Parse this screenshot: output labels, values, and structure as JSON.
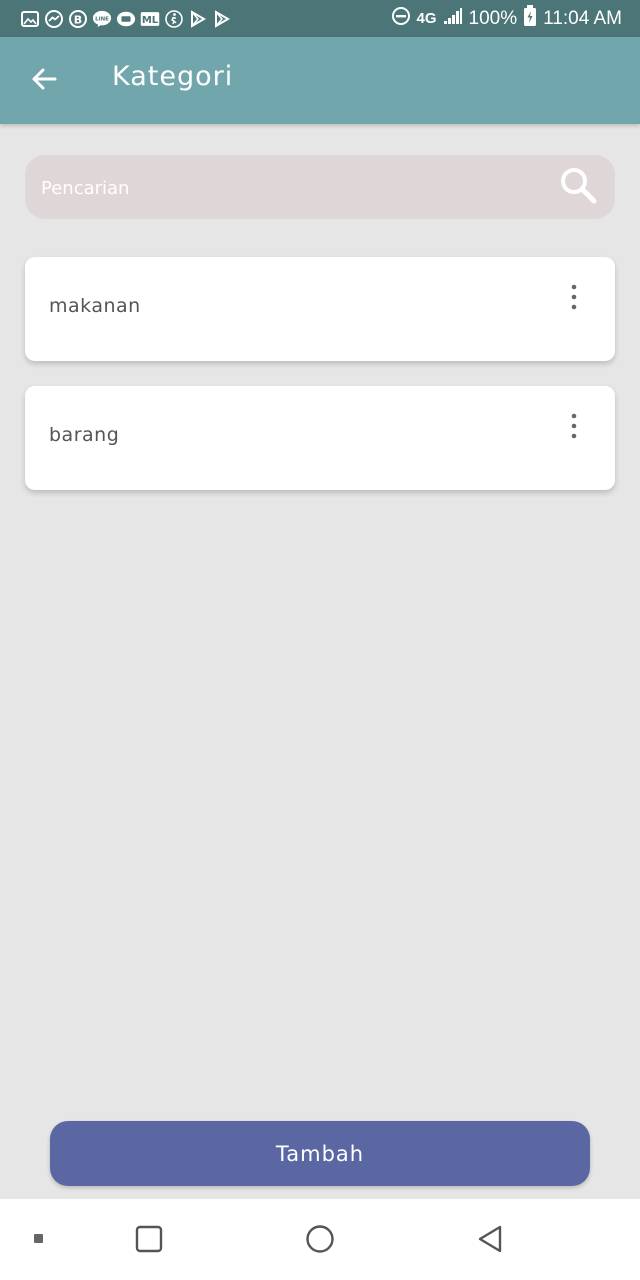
{
  "status_bar": {
    "network": "4G",
    "battery": "100%",
    "time": "11:04 AM",
    "background_color": "#4b7577"
  },
  "app_bar": {
    "title": "Kategori",
    "back_icon": "arrow-left-icon",
    "background_color": "#71a6ad"
  },
  "search": {
    "placeholder": "Pencarian",
    "value": "",
    "icon": "search-icon"
  },
  "categories": [
    {
      "label": "makanan",
      "menu_icon": "more-vertical-icon"
    },
    {
      "label": "barang",
      "menu_icon": "more-vertical-icon"
    }
  ],
  "add_button": {
    "label": "Tambah",
    "color": "#5a67a3"
  },
  "nav_bar": {
    "buttons": [
      "recent-apps-icon",
      "home-icon",
      "back-icon"
    ]
  }
}
